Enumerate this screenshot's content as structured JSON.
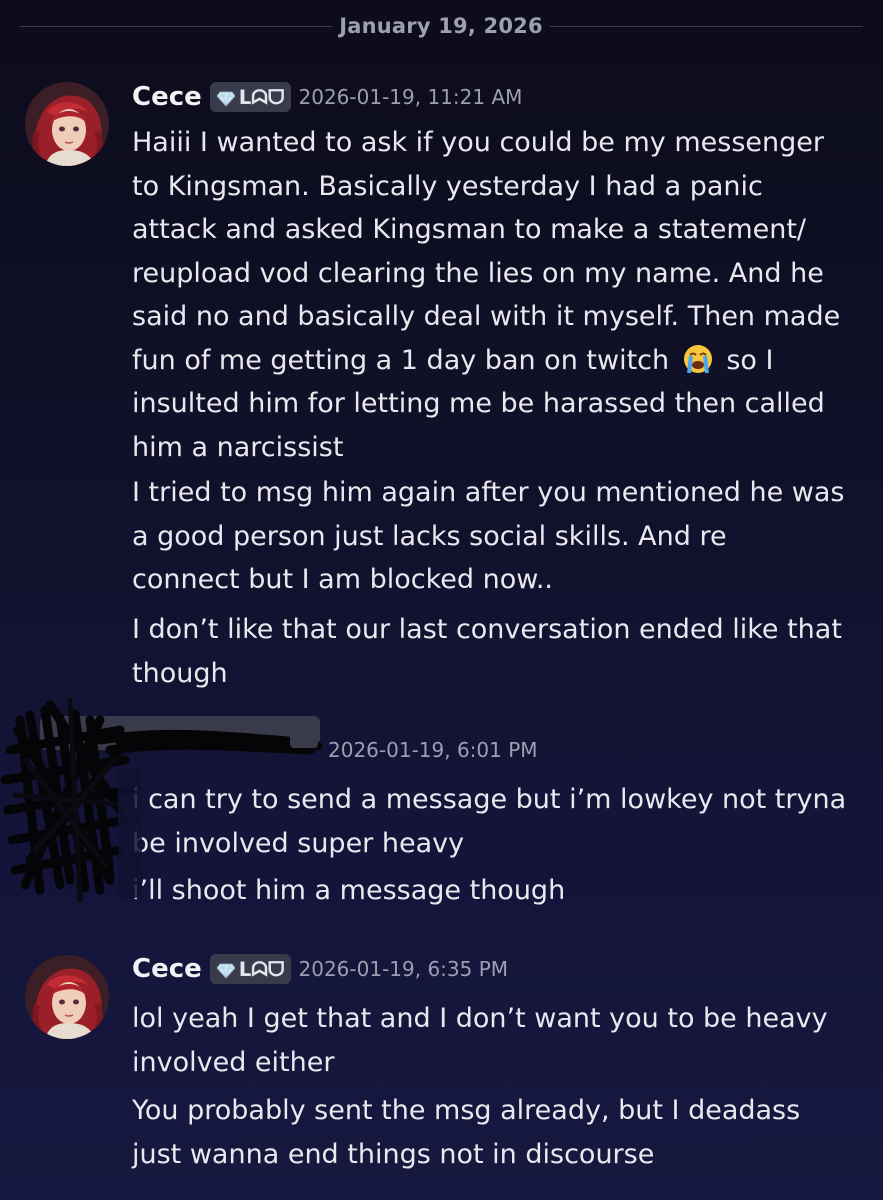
{
  "date_divider": "January 19, 2026",
  "messages": [
    {
      "author": "Cece",
      "tag": "ᒪᗣᗜ",
      "timestamp": "2026-01-19, 11:21 AM",
      "lines": [
        "Haiii I wanted to ask if you could be my messenger",
        "to Kingsman. Basically yesterday I had a panic",
        "attack and asked Kingsman to make a statement/",
        "reupload vod clearing the lies on my name. And he",
        "said no and basically deal with it myself. Then made",
        "fun of me getting a 1 day ban on twitch",
        "so I",
        "insulted him for letting me be harassed then called",
        "him a narcissist",
        "I tried to msg him again after you mentioned he was",
        "a good person just lacks social skills. And re",
        "connect but I am blocked now..",
        "I don’t like that our last conversation ended like that",
        "though"
      ]
    },
    {
      "timestamp": "2026-01-19, 6:01 PM",
      "lines": [
        "i can try to send a message but i’m lowkey not tryna",
        "be involved super heavy",
        "i’ll shoot him a message though"
      ]
    },
    {
      "author": "Cece",
      "tag": "ᒪᗣᗜ",
      "timestamp": "2026-01-19, 6:35 PM",
      "lines": [
        "lol yeah I get that and I don’t want you to be heavy",
        "involved either",
        "You probably sent the msg already, but I deadass",
        "just wanna end things not in discourse"
      ]
    }
  ],
  "icons": {
    "tag_gem": "gem-icon",
    "crying_emoji": "loudly-crying-face-emoji"
  },
  "colors": {
    "background_top": "#0c0c1c",
    "background_bottom": "#17183f",
    "text": "#e8e8ee",
    "muted": "#9d9eb0",
    "badge": "#3a3b4a"
  }
}
